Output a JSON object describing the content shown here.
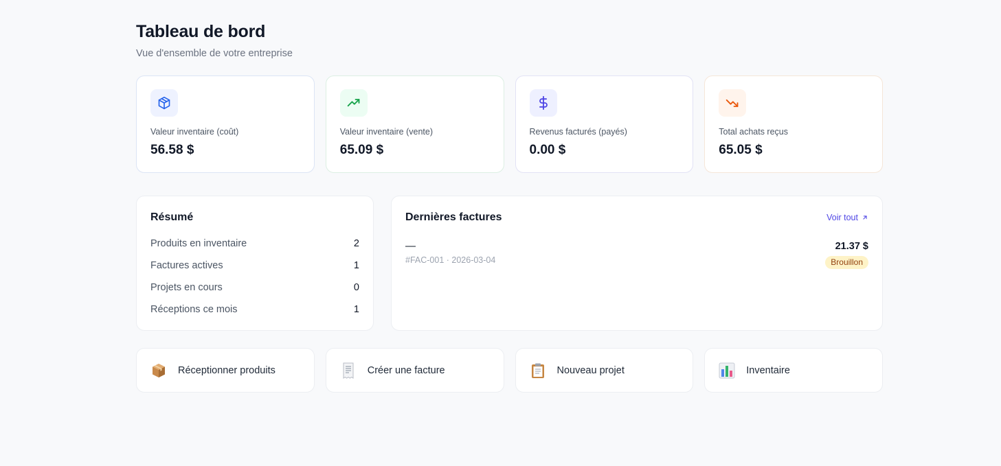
{
  "header": {
    "title": "Tableau de bord",
    "subtitle": "Vue d'ensemble de votre entreprise"
  },
  "stats": [
    {
      "icon": "box-icon",
      "label": "Valeur inventaire (coût)",
      "value": "56.58 $",
      "color": "#2563eb",
      "bg": "#eef2ff"
    },
    {
      "icon": "trending-up-icon",
      "label": "Valeur inventaire (vente)",
      "value": "65.09 $",
      "color": "#16a34a",
      "bg": "#ecfdf3"
    },
    {
      "icon": "dollar-icon",
      "label": "Revenus facturés (payés)",
      "value": "0.00 $",
      "color": "#4f46e5",
      "bg": "#eef0ff"
    },
    {
      "icon": "trending-down-icon",
      "label": "Total achats reçus",
      "value": "65.05 $",
      "color": "#ea580c",
      "bg": "#fff4ec"
    }
  ],
  "summary": {
    "title": "Résumé",
    "rows": [
      {
        "label": "Produits en inventaire",
        "value": "2"
      },
      {
        "label": "Factures actives",
        "value": "1"
      },
      {
        "label": "Projets en cours",
        "value": "0"
      },
      {
        "label": "Réceptions ce mois",
        "value": "1"
      }
    ]
  },
  "invoices": {
    "title": "Dernières factures",
    "view_all": "Voir tout",
    "items": [
      {
        "name": "—",
        "meta": "#FAC-001 · 2026-03-04",
        "amount": "21.37 $",
        "status": "Brouillon"
      }
    ]
  },
  "actions": [
    {
      "icon": "package-icon",
      "label": "Réceptionner produits"
    },
    {
      "icon": "receipt-icon",
      "label": "Créer une facture"
    },
    {
      "icon": "clipboard-icon",
      "label": "Nouveau projet"
    },
    {
      "icon": "bar-chart-icon",
      "label": "Inventaire"
    }
  ]
}
